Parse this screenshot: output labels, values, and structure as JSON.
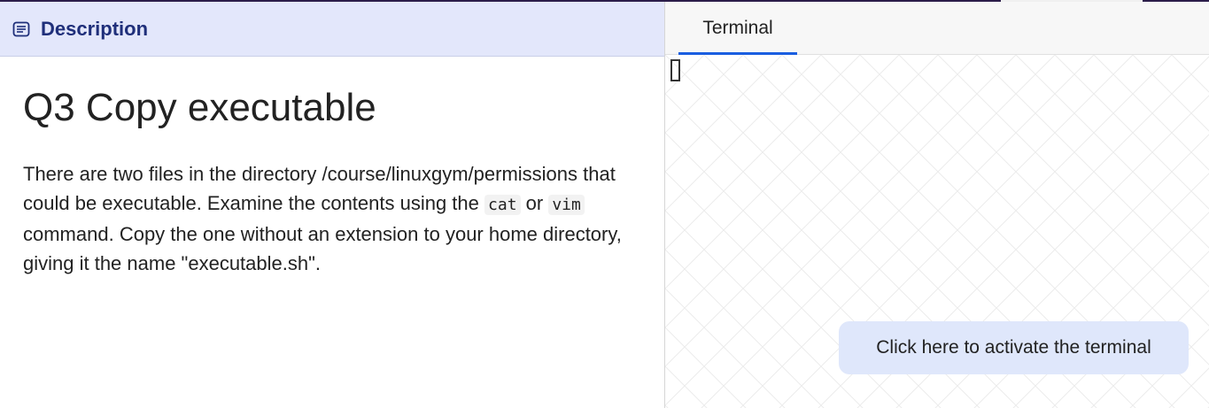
{
  "description_tab": {
    "icon": "list-icon",
    "label": "Description"
  },
  "question": {
    "title": "Q3 Copy executable",
    "text_parts": {
      "p1": "There are two files in the directory /course/linuxgym/permissions that could be executable. Examine the contents using the ",
      "code1": "cat",
      "p2": " or ",
      "code2": "vim",
      "p3": " command. Copy the one without an extension to your home directory, giving it the name \"executable.sh\"."
    }
  },
  "terminal": {
    "tab_label": "Terminal",
    "activate_label": "Click here to activate the terminal",
    "accent_color": "#1a5ee0"
  }
}
